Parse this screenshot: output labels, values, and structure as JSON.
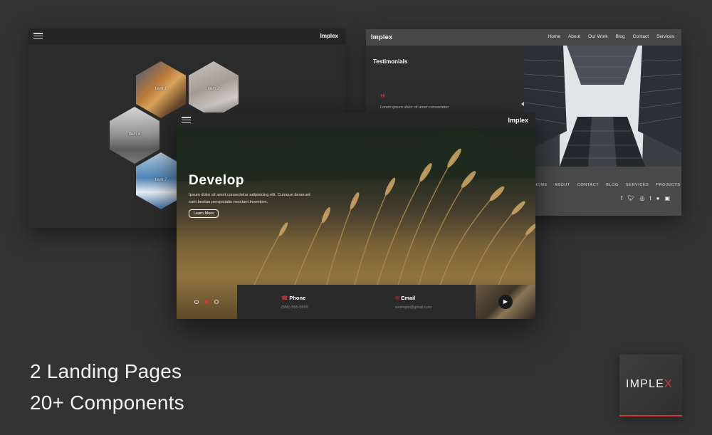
{
  "left_mockup": {
    "brand": "Implex",
    "hex_items": [
      "Item 1",
      "Item 2",
      "Item 4",
      "Item 7"
    ]
  },
  "right_mockup": {
    "brand": "Implex",
    "nav": [
      "Home",
      "About",
      "Our Work",
      "Blog",
      "Contact",
      "Services"
    ],
    "section_title": "Testimonials",
    "quote_mark": "”",
    "quote_text": "Lorem ipsum dolor sit amet consectetur.",
    "footer_links": [
      "HOME",
      "ABOUT",
      "CONTACT",
      "BLOG",
      "SERVICES",
      "PROJECTS"
    ],
    "social_icons": [
      "facebook-icon",
      "twitter-icon",
      "instagram-icon",
      "tumblr-icon",
      "apple-icon",
      "twitch-icon"
    ]
  },
  "front_mockup": {
    "brand": "Implex",
    "hero_title": "Develop",
    "hero_subtitle": "Ipsum dolor sit amet consectetur adipisicing elit. Cumque deserunt sunt beatae perspiciatis nesciunt inventore.",
    "cta_label": "Learn More",
    "phone_label": "Phone",
    "phone_value": "(555) 555-5555",
    "email_label": "Email",
    "email_value": "example@gmail.com",
    "slider": {
      "count": 3,
      "active_index": 1
    }
  },
  "tagline": {
    "line1": "2 Landing Pages",
    "line2": "20+ Components"
  },
  "logo": {
    "text": "IMPLE",
    "accent_letter": "X"
  },
  "colors": {
    "accent": "#d23a3a",
    "background": "#333333"
  }
}
